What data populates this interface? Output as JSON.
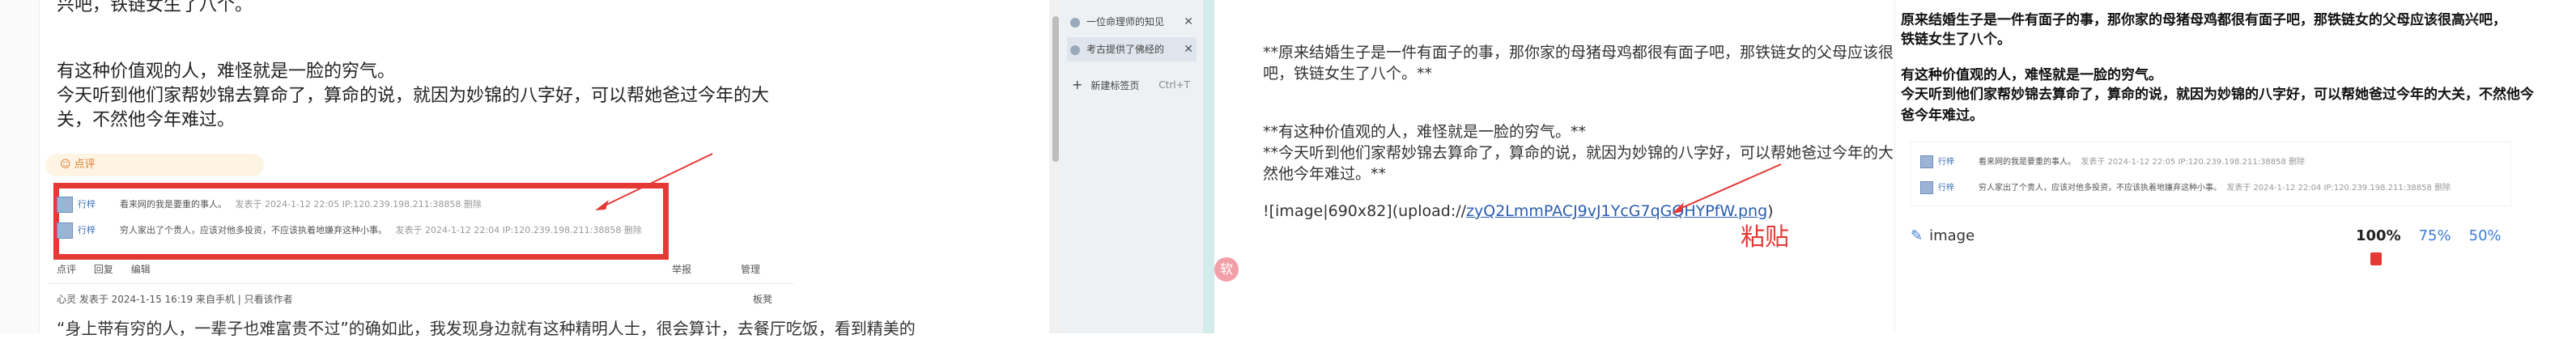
{
  "forum": {
    "top_text": "兴吧，铁链女生了八个。",
    "para1": "有这种价值观的人，难怪就是一脸的穷气。",
    "para2": "今天听到他们家帮妙锦去算命了，算命的说，就因为妙锦的八字好，可以帮她爸过今年的大",
    "para3": "关，不然他今年难过。",
    "rate_label": "☺ 点评",
    "comments": [
      {
        "user": "行梓",
        "text": "看来网的我是要重的事人。",
        "meta": "发表于 2024-1-12 22:05 IP:120.239.198.211:38858 删除"
      },
      {
        "user": "行梓",
        "text": "穷人家出了个贵人，应该对他多投资，不应该执着地嫌弃这种小事。",
        "meta": "发表于 2024-1-12 22:04 IP:120.239.198.211:38858 删除"
      }
    ],
    "actions": [
      "点评",
      "回复",
      "编辑"
    ],
    "actions_right": [
      "举报",
      "管理"
    ],
    "next_post_meta": "心灵 发表于 2024-1-15 16:19 来自手机 | 只看该作者",
    "next_post_right": "板凳",
    "next_post_text": "“身上带有穷的人，一辈子也难富贵不过”的确如此，我发现身边就有这种精明人士，很会算计，去餐厅吃饭，看到精美的"
  },
  "tabs": {
    "items": [
      {
        "label": "一位命理师的知见"
      },
      {
        "label": "考古提供了佛经的"
      }
    ],
    "new_tab_label": "新建标签页",
    "new_tab_shortcut": "Ctrl+T"
  },
  "editor": {
    "line0": "**原来结婚生子是一件有面子的事，那你家的母猪母鸡都很有面子吧，那铁链女的父母应该很高兴",
    "line1": "吧，铁链女生了八个。**",
    "line2": "**有这种价值观的人，难怪就是一脸的穷气。**",
    "line3": "**今天听到他们家帮妙锦去算命了，算命的说，就因为妙锦的八字好，可以帮她爸过今年的大关，不",
    "line4": "然他今年难过。**",
    "image_md_prefix": "![image|690x82](upload://",
    "image_md_link": "zyQ2LmmPACJ9vJ1YcG7qGQHYPfW.png",
    "image_md_suffix": ")",
    "paste_label": "粘贴",
    "badge": "软"
  },
  "preview": {
    "line0": "原来结婚生子是一件有面子的事，那你家的母猪母鸡都很有面子吧，那铁链女的父母应该很高兴吧，",
    "line1": "铁链女生了八个。",
    "line2": "有这种价值观的人，难怪就是一脸的穷气。",
    "line3": "今天听到他们家帮妙锦去算命了，算命的说，就因为妙锦的八字好，可以帮她爸过今年的大关，不然他今",
    "line4": "爸今年难过。",
    "rows": [
      {
        "user": "行梓",
        "text": "看来网的我是要重的事人。",
        "meta": "发表于 2024-1-12 22:05 IP:120.239.198.211:38858 删除"
      },
      {
        "user": "行梓",
        "text": "穷人家出了个贵人，应该对他多投资，不应该执着地嫌弃这种小事。",
        "meta": "发表于 2024-1-12 22:04 IP:120.239.198.211:38858 删除"
      }
    ],
    "image_label": "image",
    "zoom_levels": [
      "100%",
      "75%",
      "50%"
    ]
  }
}
